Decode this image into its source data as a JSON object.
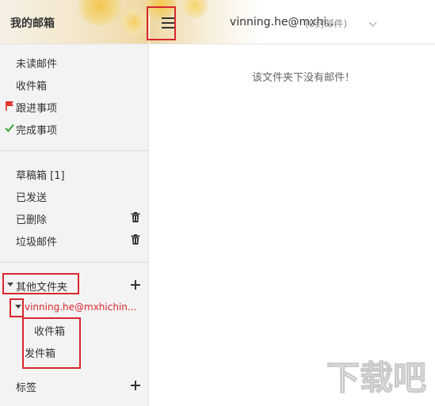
{
  "sidebar": {
    "title": "我的邮箱",
    "group1": [
      {
        "label": "未读邮件",
        "icon": ""
      },
      {
        "label": "收件箱",
        "icon": ""
      },
      {
        "label": "跟进事项",
        "icon": "red-flag-icon"
      },
      {
        "label": "完成事项",
        "icon": "green-check-icon"
      }
    ],
    "group2": [
      {
        "label": "草稿箱 [1]"
      },
      {
        "label": "已发送"
      },
      {
        "label": "已删除",
        "tail_icon": "trash-icon"
      },
      {
        "label": "垃圾邮件",
        "tail_icon": "trash-icon"
      }
    ],
    "other_folders": "其他文件夹",
    "account_folder": "vinning.he@mxhichin...",
    "subfolders": [
      {
        "label": "收件箱"
      },
      {
        "label": "发件箱"
      }
    ],
    "tags": "标签"
  },
  "header": {
    "account": "vinning.he@mxhi...",
    "count": "(0封邮件)"
  },
  "main": {
    "empty_message": "该文件夹下没有邮件！"
  },
  "watermark": {
    "text": "下载吧"
  },
  "colors": {
    "annotation_red": "#d9272e",
    "account_red": "#d9272e",
    "flag_red": "#e0322f",
    "check_green": "#3aa63a"
  }
}
